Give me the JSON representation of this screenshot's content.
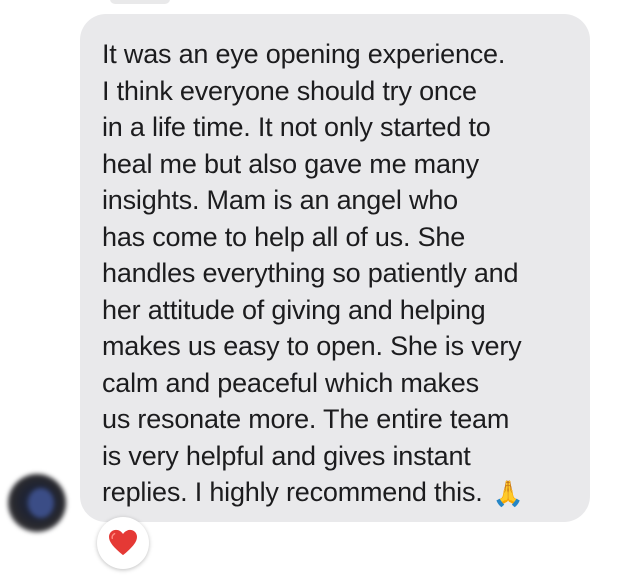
{
  "message": {
    "lines": [
      "It was an eye opening experience.",
      "I think everyone should try once",
      "in a life time. It not only started to",
      "heal me but also gave me many",
      "insights. Mam is an angel who",
      "has come to help all of us. She",
      "handles everything so patiently and",
      "her attitude of giving and helping",
      "makes us easy to open. She is very",
      "calm and peaceful which makes",
      "us resonate more. The entire team",
      "is very helpful and gives instant",
      "replies. I highly recommend this."
    ],
    "trailing_emoji": "🙏"
  },
  "reaction": {
    "icon": "red-heart-icon",
    "color": "#e53935"
  },
  "colors": {
    "bubble": "#e9e9eb",
    "text": "#1c1c1e",
    "background": "#ffffff"
  }
}
